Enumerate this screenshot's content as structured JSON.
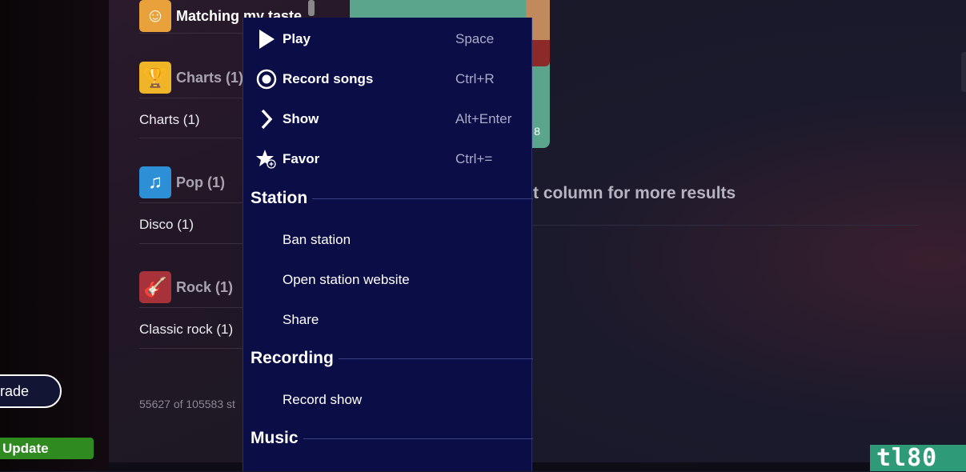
{
  "sidebar": {
    "matching": "Matching my taste",
    "categories": [
      {
        "title": "Charts (1)",
        "sub": "Charts (1)",
        "icon": "trophy-icon",
        "color": "#f0b429"
      },
      {
        "title": "Pop (1)",
        "sub": "Disco (1)",
        "icon": "music-note-icon",
        "color": "#2d8fd5"
      },
      {
        "title": "Rock (1)",
        "sub": "Classic rock (1)",
        "icon": "guitar-icon",
        "color": "#a8323a"
      }
    ],
    "count": "55627 of 105583 st",
    "upgrade": "rade",
    "update": "Update"
  },
  "card": {
    "number": "8"
  },
  "main": {
    "hint": "t column for more results"
  },
  "menu": {
    "actions": [
      {
        "label": "Play",
        "shortcut": "Space",
        "icon": "play-icon"
      },
      {
        "label": "Record songs",
        "shortcut": "Ctrl+R",
        "icon": "record-icon"
      },
      {
        "label": "Show",
        "shortcut": "Alt+Enter",
        "icon": "chevron-right-icon"
      },
      {
        "label": "Favor",
        "shortcut": "Ctrl+=",
        "icon": "star-plus-icon"
      }
    ],
    "station": {
      "title": "Station",
      "items": [
        "Ban station",
        "Open station website",
        "Share"
      ]
    },
    "recording": {
      "title": "Recording",
      "items": [
        "Record show"
      ]
    },
    "music": {
      "title": "Music"
    }
  },
  "watermark": "tl80",
  "colors": {
    "menu_bg": "#0b0e46",
    "update_green": "#2f8a1f",
    "card_teal": "#5aa58c"
  }
}
